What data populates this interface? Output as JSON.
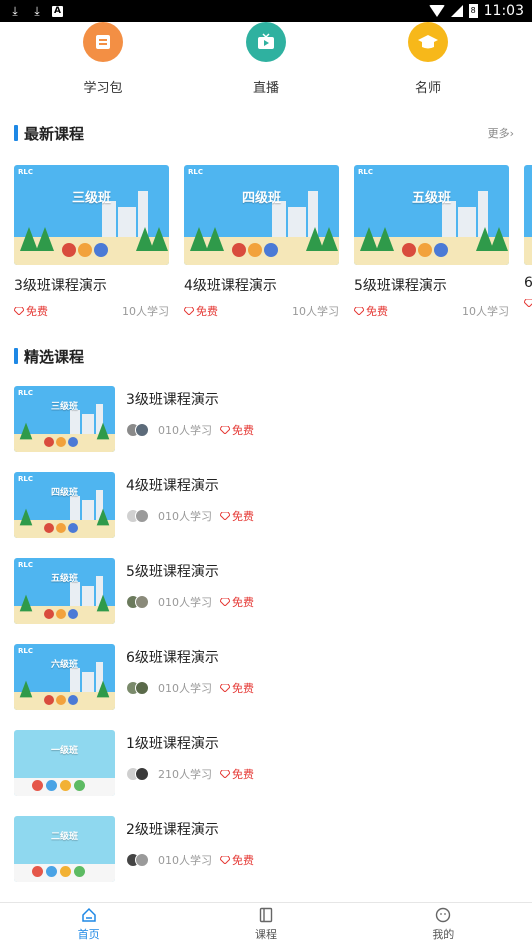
{
  "status_bar": {
    "time": "11:03",
    "battery": "8",
    "left_icons": [
      "download-icon",
      "download-icon",
      "notification-icon"
    ]
  },
  "categories": [
    {
      "label": "学习包",
      "color": "#f38f44",
      "icon": "book-icon"
    },
    {
      "label": "直播",
      "color": "#2fb1a0",
      "icon": "tv-icon"
    },
    {
      "label": "名师",
      "color": "#f7b81a",
      "icon": "graduation-cap-icon"
    }
  ],
  "latest": {
    "title": "最新课程",
    "more_label": "更多",
    "items": [
      {
        "thumb_title": "三级班",
        "name": "3级班课程演示",
        "free_label": "免费",
        "learners": "10人学习"
      },
      {
        "thumb_title": "四级班",
        "name": "4级班课程演示",
        "free_label": "免费",
        "learners": "10人学习"
      },
      {
        "thumb_title": "五级班",
        "name": "5级班课程演示",
        "free_label": "免费",
        "learners": "10人学习"
      },
      {
        "thumb_title": "",
        "name": "6",
        "free_label": "",
        "learners": ""
      }
    ]
  },
  "featured": {
    "title": "精选课程",
    "items": [
      {
        "thumb_title": "三级班",
        "name": "3级班课程演示",
        "learners": "010人学习",
        "free_label": "免费",
        "style": "blue"
      },
      {
        "thumb_title": "四级班",
        "name": "4级班课程演示",
        "learners": "010人学习",
        "free_label": "免费",
        "style": "blue"
      },
      {
        "thumb_title": "五级班",
        "name": "5级班课程演示",
        "learners": "010人学习",
        "free_label": "免费",
        "style": "blue"
      },
      {
        "thumb_title": "六级班",
        "name": "6级班课程演示",
        "learners": "010人学习",
        "free_label": "免费",
        "style": "blue"
      },
      {
        "thumb_title": "一级班",
        "name": "1级班课程演示",
        "learners": "210人学习",
        "free_label": "免费",
        "style": "light"
      },
      {
        "thumb_title": "二级班",
        "name": "2级班课程演示",
        "learners": "010人学习",
        "free_label": "免费",
        "style": "light"
      }
    ]
  },
  "bottom_nav": [
    {
      "label": "首页",
      "icon": "home-icon",
      "active": true
    },
    {
      "label": "课程",
      "icon": "book-icon",
      "active": false
    },
    {
      "label": "我的",
      "icon": "profile-icon",
      "active": false
    }
  ],
  "colors": {
    "accent": "#1e88e5",
    "free": "#e53935"
  }
}
